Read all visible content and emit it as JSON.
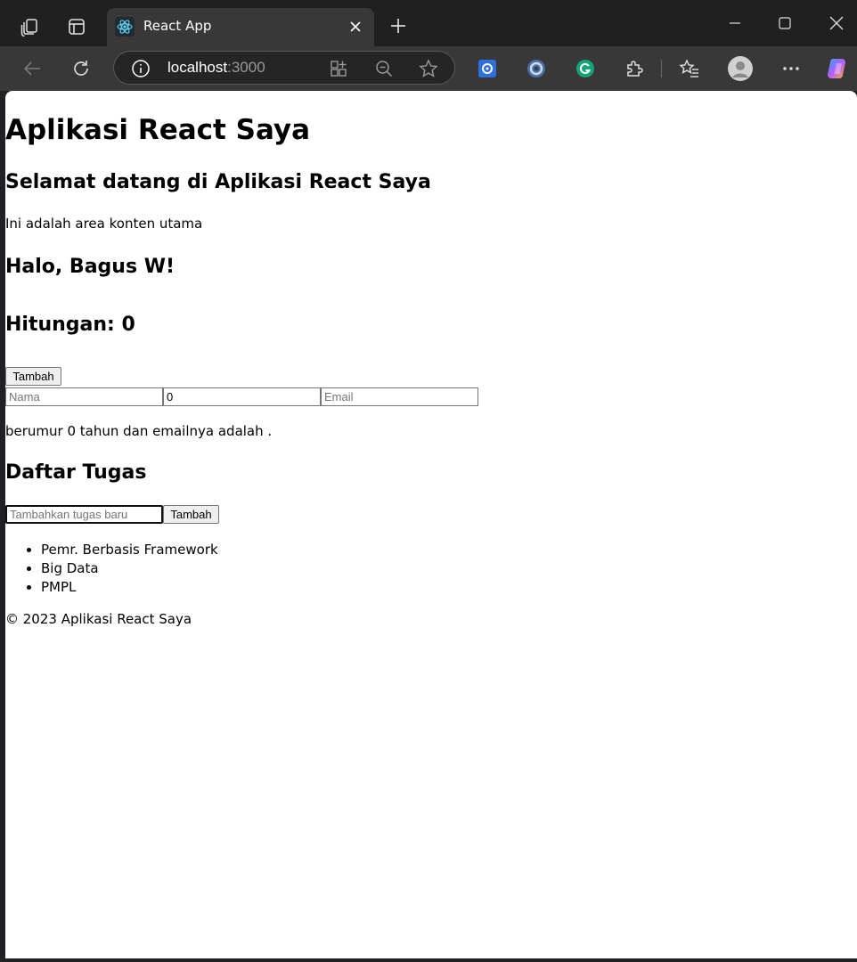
{
  "browser": {
    "tab": {
      "title": "React App",
      "favicon": "react-logo-icon"
    },
    "address_bar": {
      "host": "localhost",
      "port": ":3000"
    },
    "colors": {
      "frame": "#202020",
      "toolbar": "#383838",
      "page": "#ffffff"
    }
  },
  "page": {
    "app_title": "Aplikasi React Saya",
    "welcome_heading": "Selamat datang di Aplikasi React Saya",
    "main_content_text": "Ini adalah area konten utama",
    "greeting": "Halo, Bagus W!",
    "counter_heading": "Hitungan: 0",
    "add_button_label": "Tambah",
    "form": {
      "name": {
        "value": "",
        "placeholder": "Nama"
      },
      "age": {
        "value": "0",
        "placeholder": ""
      },
      "email": {
        "value": "",
        "placeholder": "Email"
      }
    },
    "summary_text": "berumur 0 tahun dan emailnya adalah .",
    "tasks": {
      "heading": "Daftar Tugas",
      "input_placeholder": "Tambahkan tugas baru",
      "add_button_label": "Tambah",
      "items": [
        "Pemr. Berbasis Framework",
        "Big Data",
        "PMPL"
      ]
    },
    "footer": "© 2023 Aplikasi React Saya"
  }
}
